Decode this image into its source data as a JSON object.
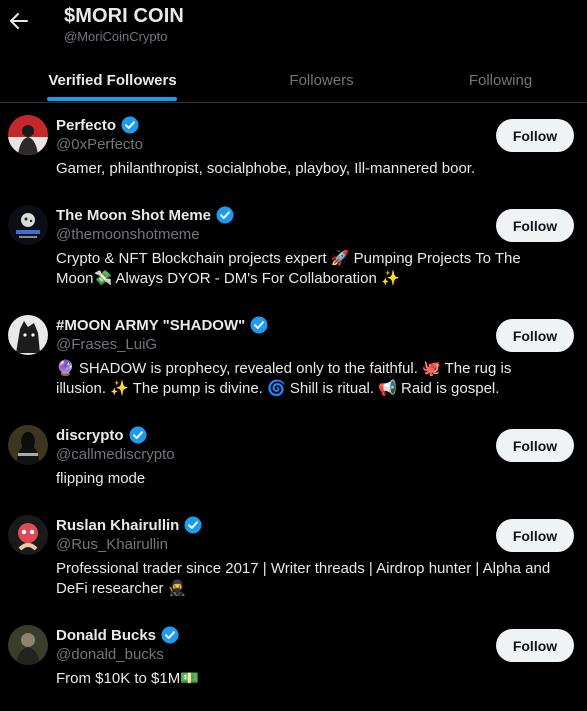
{
  "header": {
    "title": "$MORI COIN",
    "handle": "@MoriCoinCrypto"
  },
  "tabs": [
    {
      "label": "Verified Followers",
      "active": true
    },
    {
      "label": "Followers",
      "active": false
    },
    {
      "label": "Following",
      "active": false
    }
  ],
  "follow_label": "Follow",
  "colors": {
    "accent": "#1d9bf0",
    "background": "#000000",
    "muted_text": "#71767b",
    "primary_text": "#e7e9ea",
    "follow_button_bg": "#eff3f4"
  },
  "users": [
    {
      "name": "Perfecto",
      "handle": "@0xPerfecto",
      "bio_lines": [
        "Gamer, philanthropist, socialphobe, playboy, Ill-mannered boor."
      ]
    },
    {
      "name": "The Moon Shot Meme",
      "handle": "@themoonshotmeme",
      "bio_lines": [
        "Crypto & NFT Blockchain projects expert 🚀 Pumping Projects To The",
        "Moon💸 Always DYOR - DM's For Collaboration ✨"
      ]
    },
    {
      "name": "#MOON ARMY \"SHADOW\"",
      "handle": "@Frases_LuiG",
      "bio_lines": [
        "🔮 SHADOW is prophecy, revealed only to the faithful. 🐙 The rug is",
        "illusion. ✨ The pump is divine. 🌀 Shill is ritual. 📢 Raid is gospel."
      ]
    },
    {
      "name": "discrypto",
      "handle": "@callmediscrypto",
      "bio_lines": [
        "flipping mode"
      ]
    },
    {
      "name": "Ruslan Khairullin",
      "handle": "@Rus_Khairullin",
      "bio_lines": [
        "Professional trader since 2017 | Writer threads | Airdrop hunter | Alpha and",
        "DeFi researcher 🥷"
      ]
    },
    {
      "name": "Donald Bucks",
      "handle": "@donald_bucks",
      "bio_lines": [
        "From $10K to $1M💵"
      ]
    }
  ]
}
